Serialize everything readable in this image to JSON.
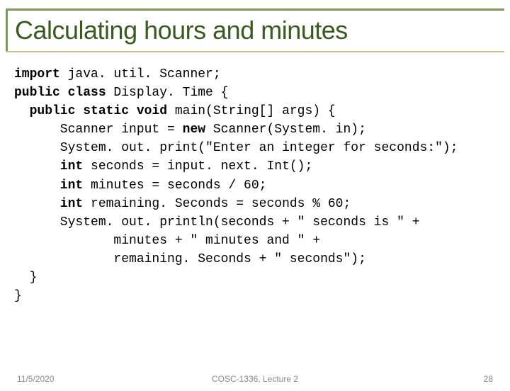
{
  "slide": {
    "title": "Calculating hours and minutes",
    "code": {
      "l1a": "import",
      "l1b": " java. util. Scanner;",
      "l2a": "public class",
      "l2b": " Display. Time {",
      "l3a": "  public static void",
      "l3b": " main(String[] args) {",
      "l4a": "      Scanner input = ",
      "l4b": "new",
      "l4c": " Scanner(System. in);",
      "l5": "      System. out. print(\"Enter an integer for seconds:\");",
      "l6a": "      int",
      "l6b": " seconds = input. next. Int();",
      "l7a": "      int",
      "l7b": " minutes = seconds / 60;",
      "l8a": "      int",
      "l8b": " remaining. Seconds = seconds % 60;",
      "l9": "      System. out. println(seconds + \" seconds is \" +",
      "l10": "             minutes + \" minutes and \" +",
      "l11": "             remaining. Seconds + \" seconds\");",
      "l12": "  }",
      "l13": "}"
    },
    "footer": {
      "date": "11/5/2020",
      "course": "COSC-1336, Lecture 2",
      "page": "28"
    }
  }
}
